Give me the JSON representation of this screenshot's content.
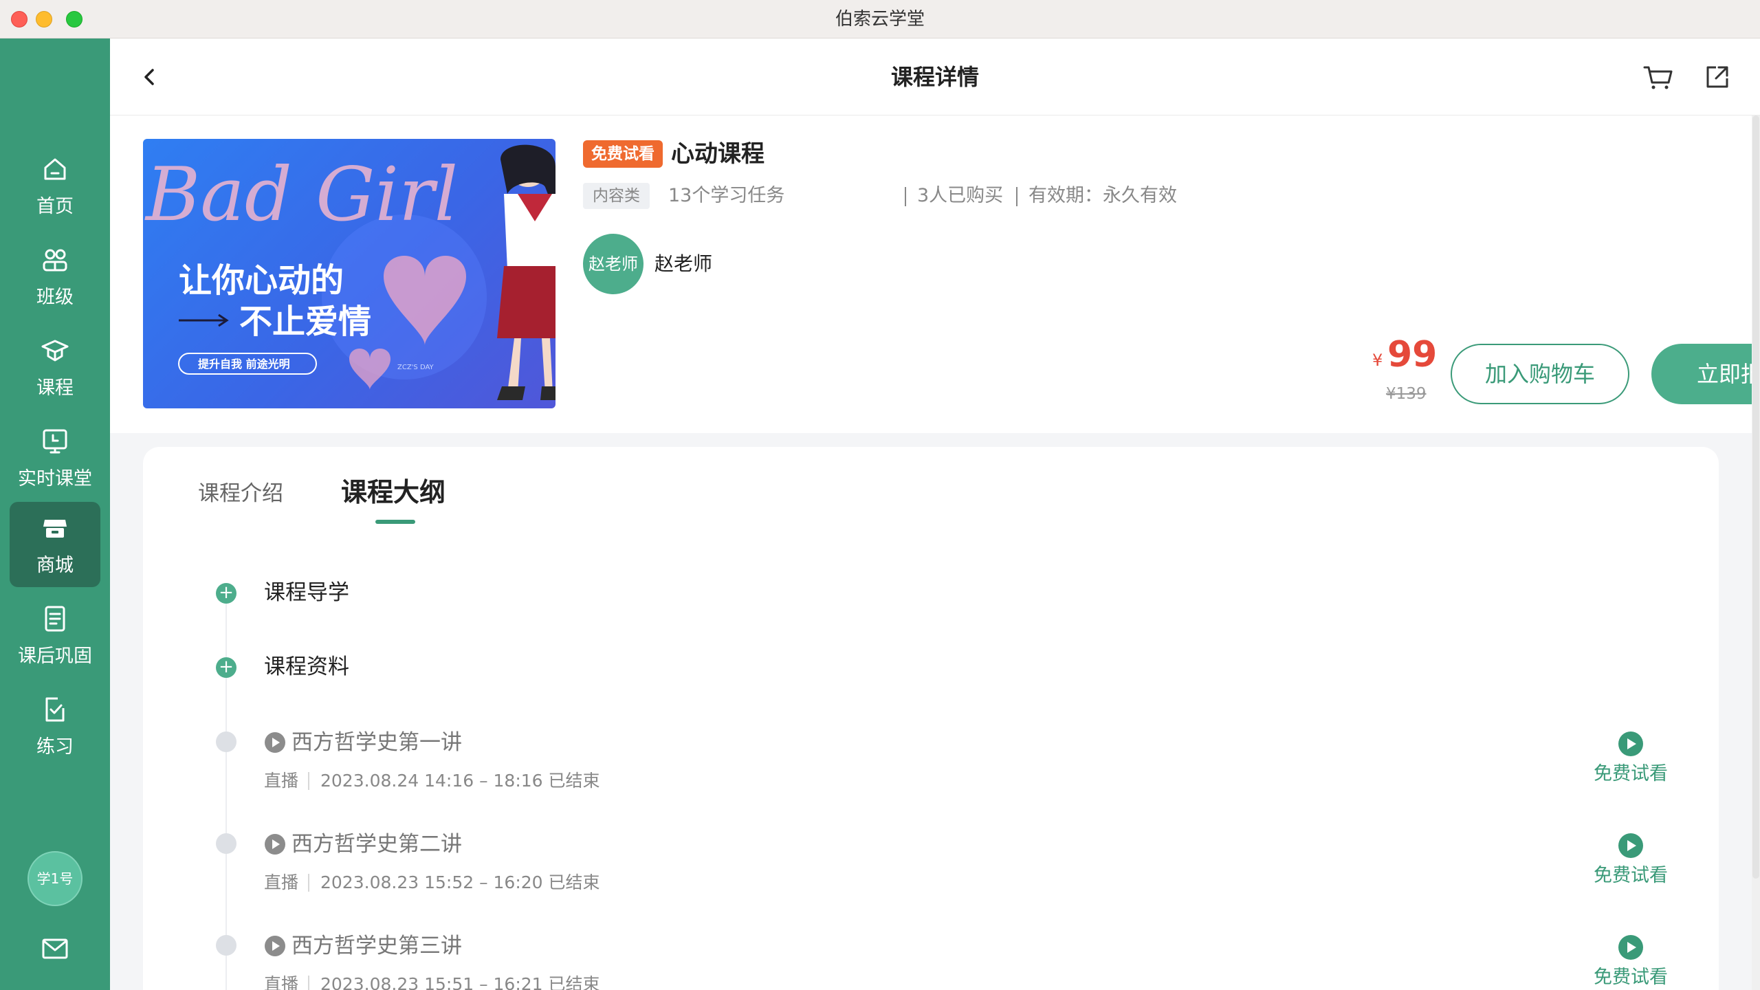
{
  "window": {
    "title": "伯索云学堂"
  },
  "sidebar": {
    "items": [
      {
        "label": "首页",
        "icon": "home-icon",
        "active": false
      },
      {
        "label": "班级",
        "icon": "class-icon",
        "active": false
      },
      {
        "label": "课程",
        "icon": "course-icon",
        "active": false
      },
      {
        "label": "实时课堂",
        "icon": "live-class-icon",
        "active": false
      },
      {
        "label": "商城",
        "icon": "store-icon",
        "active": true
      },
      {
        "label": "课后巩固",
        "icon": "review-icon",
        "active": false
      },
      {
        "label": "练习",
        "icon": "practice-icon",
        "active": false
      }
    ],
    "user_avatar": "学1号",
    "mail_icon": "mail-icon"
  },
  "header": {
    "title": "课程详情"
  },
  "course": {
    "badge": "免费试看",
    "title": "心动课程",
    "type_tag": "内容类",
    "tasks": "13个学习任务",
    "buyers": "3人已购买",
    "validity": "有效期：永久有效",
    "teacher_avatar_text": "赵老师",
    "teacher_name": "赵老师",
    "price_currency": "¥",
    "price": "99",
    "original_price": "¥139",
    "add_to_cart": "加入购物车",
    "enroll": "立即报名",
    "cover": {
      "headline": "Bad Girl",
      "line1": "让你心动的",
      "line2": "不止爱情",
      "pill": "提升自我 前途光明",
      "brand": "ZCZ'S DAY"
    }
  },
  "tabs": [
    {
      "label": "课程介绍",
      "active": false
    },
    {
      "label": "课程大纲",
      "active": true
    }
  ],
  "outline": {
    "sections": [
      {
        "title": "课程导学"
      },
      {
        "title": "课程资料"
      }
    ],
    "lessons": [
      {
        "title": "西方哲学史第一讲",
        "type": "直播",
        "time": "2023.08.24 14:16 – 18:16 已结束",
        "action": "免费试看"
      },
      {
        "title": "西方哲学史第二讲",
        "type": "直播",
        "time": "2023.08.23 15:52 – 16:20 已结束",
        "action": "免费试看"
      },
      {
        "title": "西方哲学史第三讲",
        "type": "直播",
        "time": "2023.08.23 15:51 – 16:21 已结束",
        "action": "免费试看"
      }
    ]
  },
  "colors": {
    "sidebar": "#3a9a78",
    "sidebar_active": "#2c6f58",
    "accent": "#4cae8c",
    "price": "#e5493a",
    "badge": "#ef6a2f"
  }
}
